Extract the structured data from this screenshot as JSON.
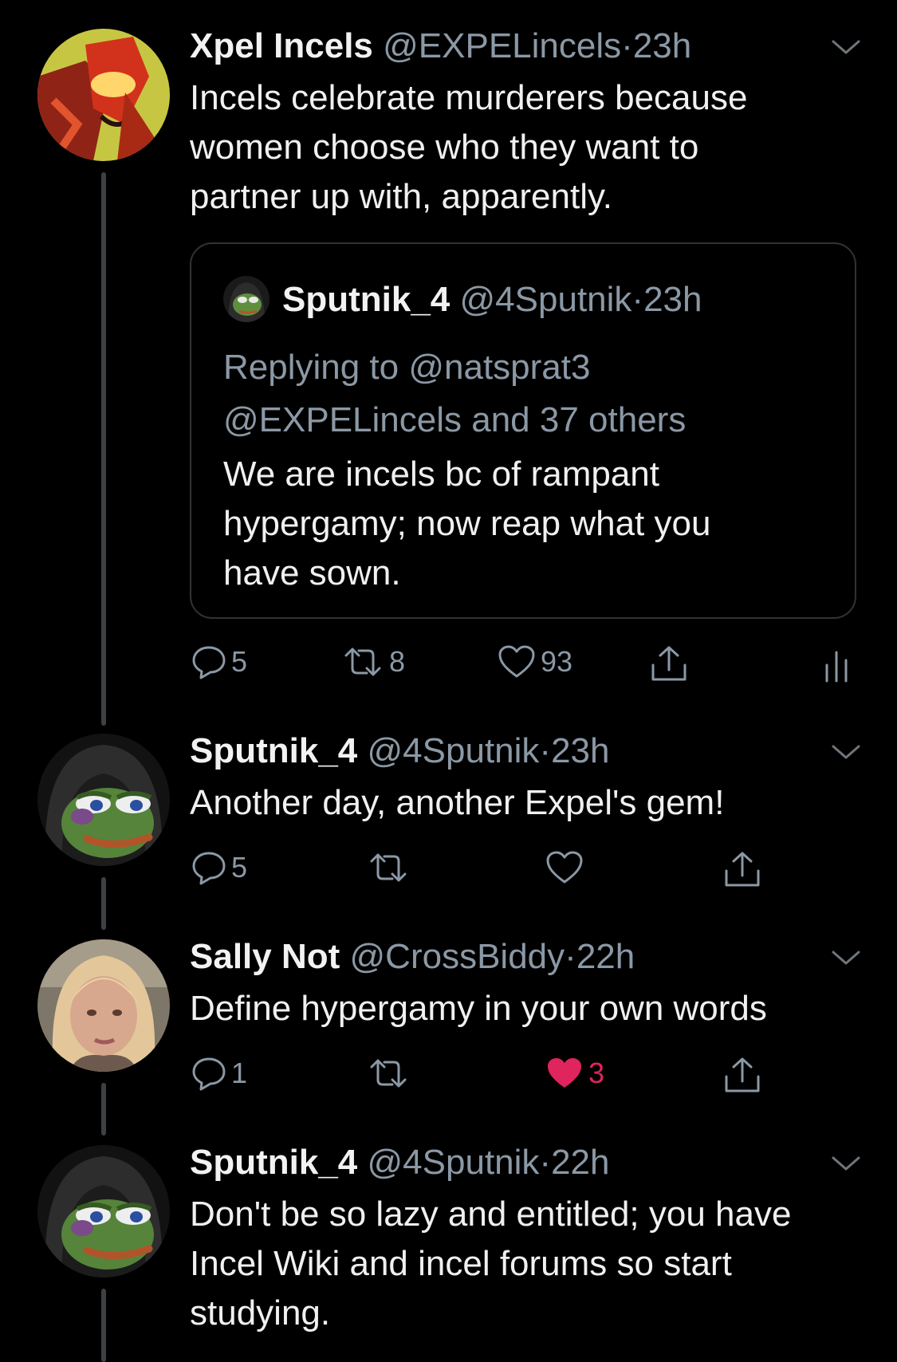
{
  "tweets": [
    {
      "name": "Xpel Incels",
      "handle": "@EXPELincels",
      "dot": "·",
      "time": "23h",
      "text_lines": [
        "Incels celebrate murderers because",
        "women choose who they want to",
        "partner up with, apparently."
      ],
      "quote": {
        "name": "Sputnik_4",
        "handle": "@4Sputnik",
        "dot": "·",
        "time": "23h",
        "reply_line1": "Replying to @natsprat3",
        "reply_line2": "@EXPELincels and 37 others",
        "text_lines": [
          "We are incels bc of rampant",
          "hypergamy; now reap what you",
          "have sown."
        ]
      },
      "replies": "5",
      "retweets": "8",
      "likes": "93"
    },
    {
      "name": "Sputnik_4",
      "handle": "@4Sputnik",
      "dot": "·",
      "time": "23h",
      "text_lines": [
        "Another day, another Expel's gem!"
      ],
      "replies": "5",
      "retweets": "",
      "likes": ""
    },
    {
      "name": "Sally Not",
      "handle": "@CrossBiddy",
      "dot": "·",
      "time": "22h",
      "text_lines": [
        "Define hypergamy in your own words"
      ],
      "replies": "1",
      "retweets": "",
      "likes": "3"
    },
    {
      "name": "Sputnik_4",
      "handle": "@4Sputnik",
      "dot": "·",
      "time": "22h",
      "text_lines": [
        "Don't be so lazy and entitled; you have",
        "Incel Wiki and incel forums so start",
        "studying."
      ]
    }
  ],
  "icons": {
    "reply": "reply-icon",
    "retweet": "retweet-icon",
    "like": "heart-icon",
    "share": "share-icon",
    "analytics": "analytics-icon",
    "menu": "chevron-down-icon"
  },
  "colors": {
    "background": "#000000",
    "text": "#f0f0f0",
    "secondary": "#8b98a5",
    "like_active": "#e0245e",
    "thread_line": "#3d4144"
  }
}
